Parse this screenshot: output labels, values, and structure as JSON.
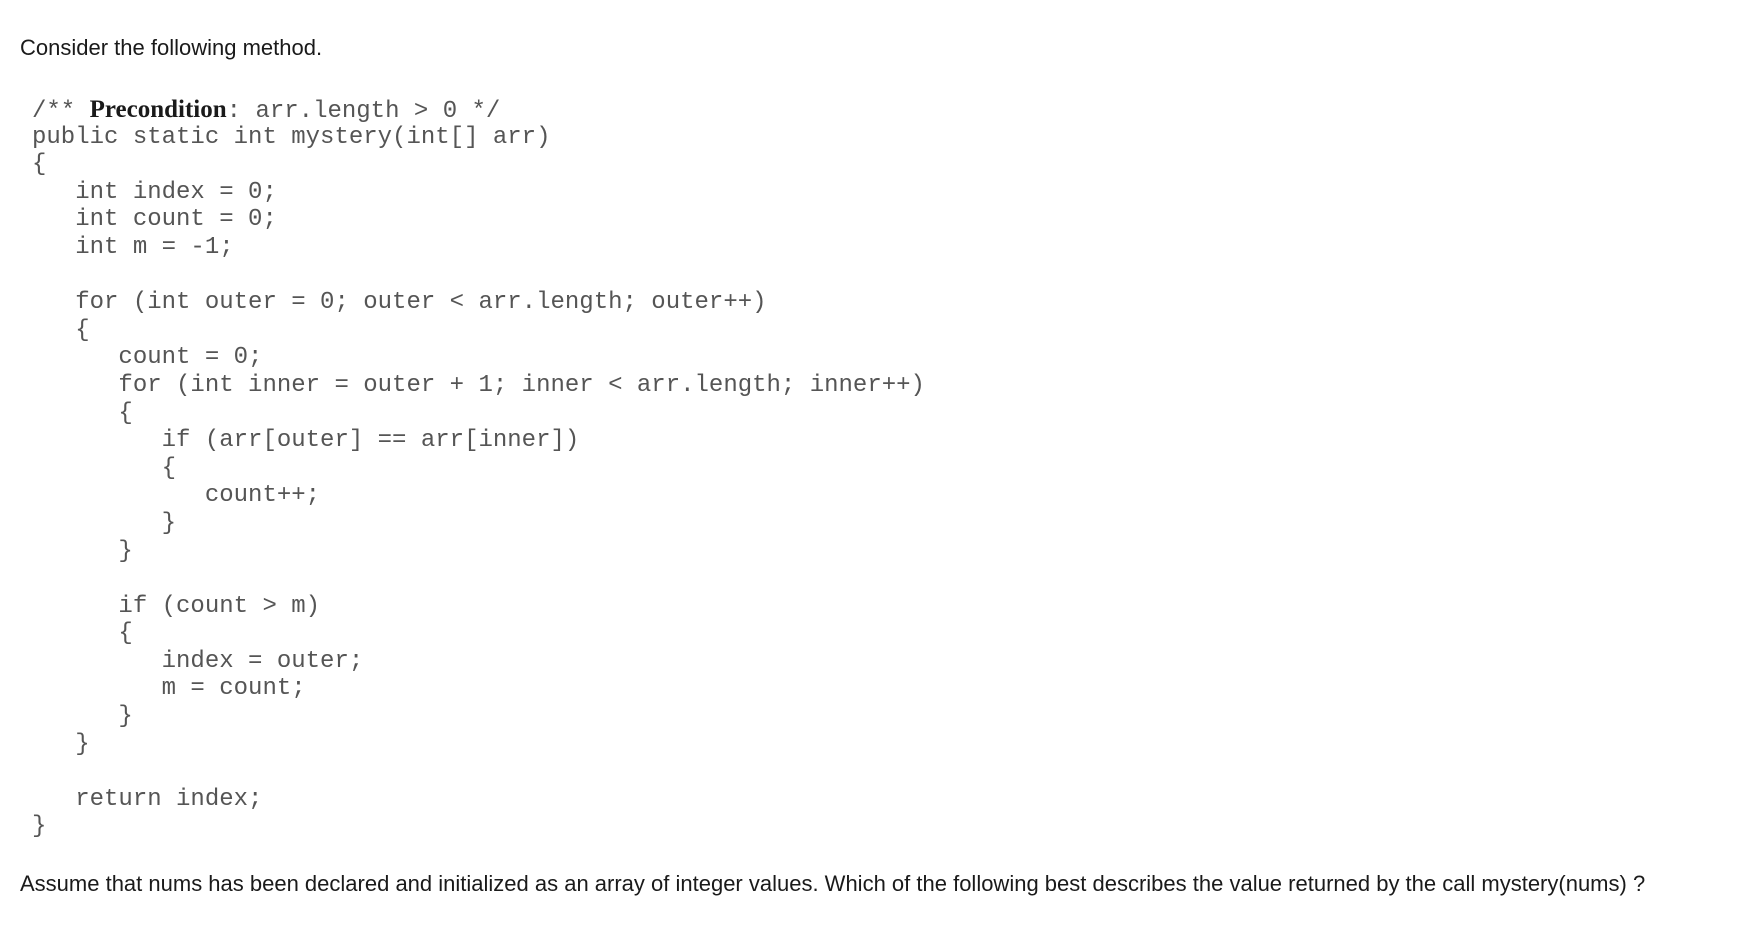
{
  "intro_text": "Consider the following method.",
  "code": {
    "comment_open": "/** ",
    "precondition_label": "Precondition",
    "comment_rest": ": arr.length > 0 */",
    "lines": [
      "public static int mystery(int[] arr)",
      "{",
      "   int index = 0;",
      "   int count = 0;",
      "   int m = -1;",
      "",
      "   for (int outer = 0; outer < arr.length; outer++)",
      "   {",
      "      count = 0;",
      "      for (int inner = outer + 1; inner < arr.length; inner++)",
      "      {",
      "         if (arr[outer] == arr[inner])",
      "         {",
      "            count++;",
      "         }",
      "      }",
      "",
      "      if (count > m)",
      "      {",
      "         index = outer;",
      "         m = count;",
      "      }",
      "   }",
      "",
      "   return index;",
      "}"
    ]
  },
  "question_text": "Assume that nums has been declared and initialized as an array of integer values. Which of the following best describes the value returned by the call mystery(nums) ?"
}
